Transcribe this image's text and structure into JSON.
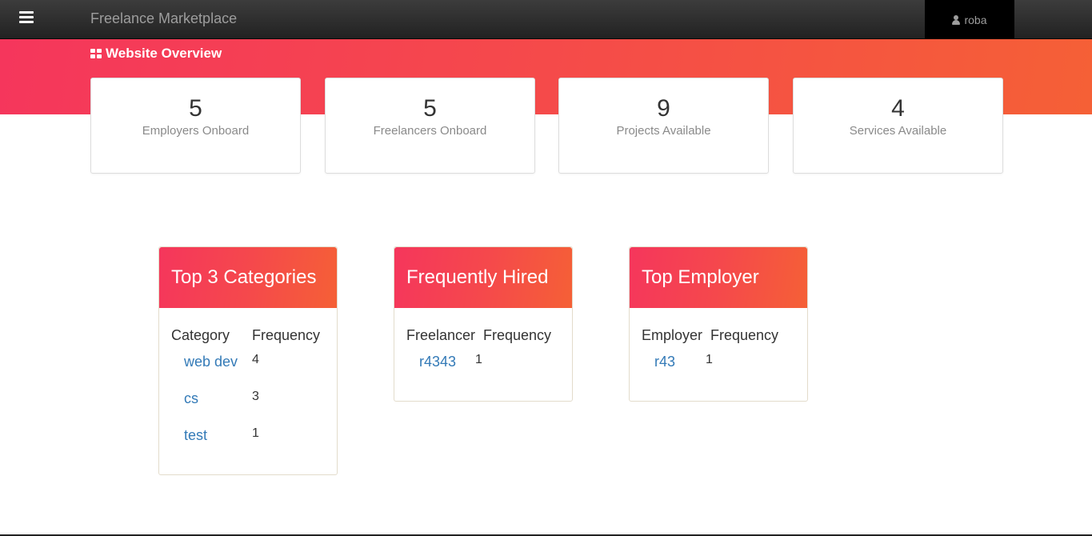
{
  "nav": {
    "brand": "Freelance Marketplace",
    "user": "roba"
  },
  "overview": {
    "title": "Website Overview",
    "stats": [
      {
        "value": "5",
        "label": "Employers Onboard"
      },
      {
        "value": "5",
        "label": "Freelancers Onboard"
      },
      {
        "value": "9",
        "label": "Projects Available"
      },
      {
        "value": "4",
        "label": "Services Available"
      }
    ]
  },
  "panels": {
    "categories": {
      "title": "Top 3 Categories",
      "col1": "Category",
      "col2": "Frequency",
      "rows": [
        {
          "name": "web dev",
          "count": "4"
        },
        {
          "name": "cs",
          "count": "3"
        },
        {
          "name": "test",
          "count": "1"
        }
      ]
    },
    "hired": {
      "title": "Frequently Hired",
      "col1": "Freelancer",
      "col2": "Frequency",
      "rows": [
        {
          "name": "r4343",
          "count": "1"
        }
      ]
    },
    "employer": {
      "title": "Top Employer",
      "col1": "Employer",
      "col2": "Frequency",
      "rows": [
        {
          "name": "r43",
          "count": "1"
        }
      ]
    }
  }
}
